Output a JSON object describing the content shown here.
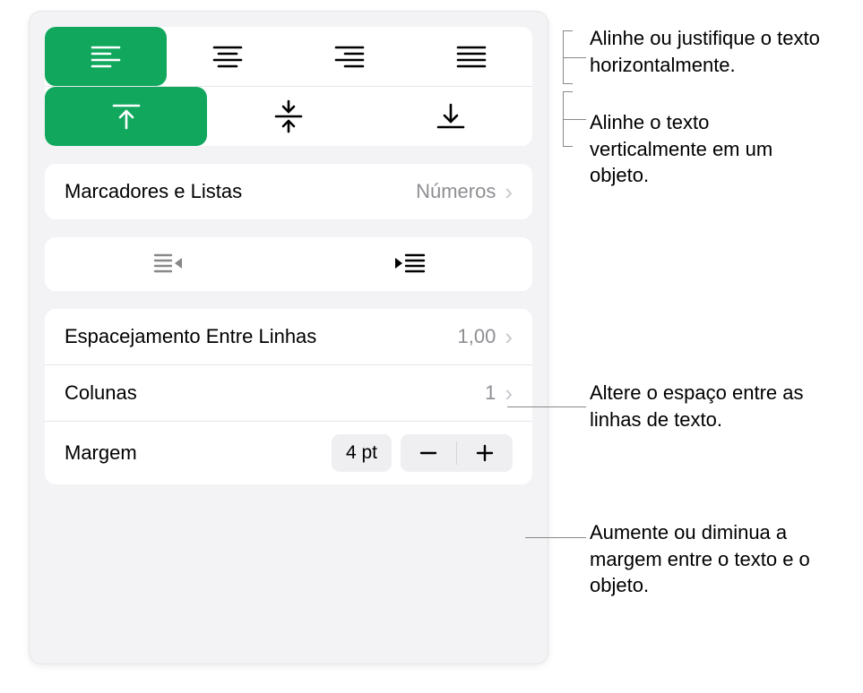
{
  "callouts": {
    "horizontal_align": "Alinhe ou justifique o texto horizontalmente.",
    "vertical_align": "Alinhe o texto verticalmente em um objeto.",
    "line_spacing": "Altere o espaço entre as linhas de texto.",
    "margin": "Aumente ou diminua a margem entre o texto e o objeto."
  },
  "sections": {
    "bullets": {
      "label": "Marcadores e Listas",
      "value": "Números"
    },
    "line_spacing": {
      "label": "Espacejamento Entre Linhas",
      "value": "1,00"
    },
    "columns": {
      "label": "Colunas",
      "value": "1"
    },
    "margin": {
      "label": "Margem",
      "value": "4 pt"
    }
  },
  "colors": {
    "accent": "#11a85e"
  }
}
